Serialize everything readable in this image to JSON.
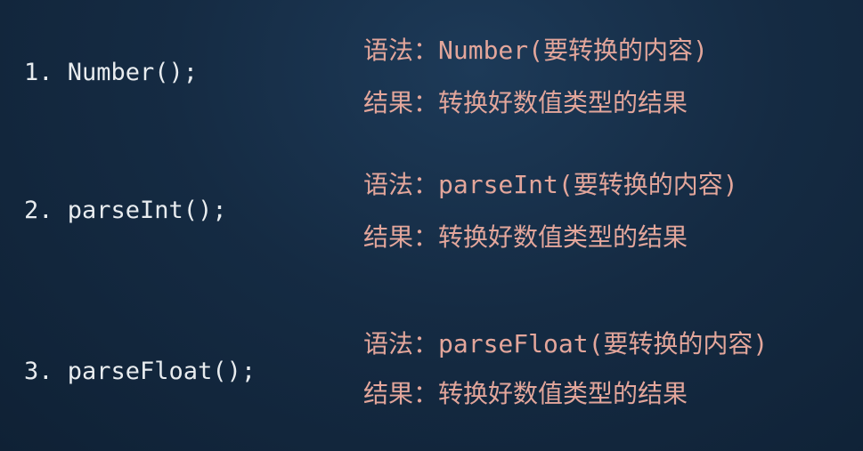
{
  "items": [
    {
      "method": "1. Number();",
      "syntax": "语法：Number(要转换的内容)",
      "result": "结果：转换好数值类型的结果"
    },
    {
      "method": "2. parseInt();",
      "syntax": "语法：parseInt(要转换的内容)",
      "result": "结果：转换好数值类型的结果"
    },
    {
      "method": "3. parseFloat();",
      "syntax": "语法：parseFloat(要转换的内容)",
      "result": "结果：转换好数值类型的结果"
    }
  ],
  "colors": {
    "background": "#152b43",
    "method_text": "#e8ecef",
    "description_text": "#e3a69b"
  }
}
